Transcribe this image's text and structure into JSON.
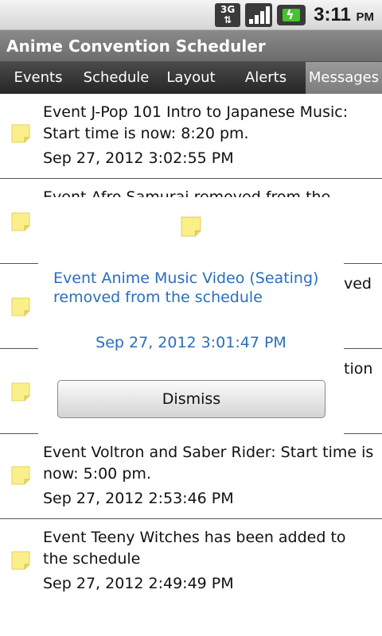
{
  "status_bar": {
    "network": "3G",
    "time": "3:11",
    "ampm": "PM",
    "icons": [
      "3g-icon",
      "signal-icon",
      "battery-charging-icon"
    ]
  },
  "app": {
    "title": "Anime Convention Scheduler"
  },
  "tabs": [
    {
      "label": "Events"
    },
    {
      "label": "Schedule"
    },
    {
      "label": "Layout"
    },
    {
      "label": "Alerts"
    },
    {
      "label": "Messages",
      "active": true
    }
  ],
  "messages": [
    {
      "text": "Event J-Pop 101 Intro to Japanese Music: Start time is now: 8:20 pm.",
      "date": "Sep 27, 2012 3:02:55 PM"
    },
    {
      "text": "Event Afro Samurai removed from the",
      "date": ""
    },
    {
      "text": "ved",
      "date": ""
    },
    {
      "text": "tion",
      "date": ""
    },
    {
      "text": "Event Voltron and Saber Rider: Start time is now: 5:00 pm.",
      "date": "Sep 27, 2012 2:53:46 PM"
    },
    {
      "text": "Event Teeny Witches  has been added to the schedule",
      "date": "Sep 27, 2012 2:49:49 PM"
    }
  ],
  "dialog": {
    "message": "Event Anime Music Video (Seating) removed from the schedule",
    "date": "Sep 27, 2012 3:01:47 PM",
    "dismiss_label": "Dismiss"
  },
  "colors": {
    "dialog_text": "#2a6ebd",
    "note_icon": "#fbef8a",
    "active_tab": "#8a8a8a"
  }
}
